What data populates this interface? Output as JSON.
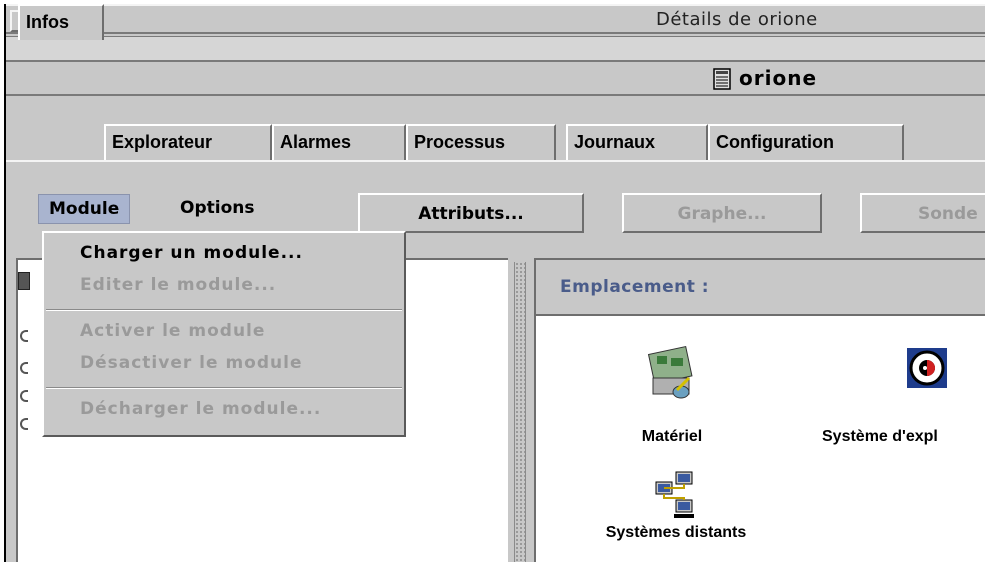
{
  "window": {
    "title": "Détails de orione"
  },
  "host": {
    "name": "orione"
  },
  "tabs": [
    {
      "label": "Infos"
    },
    {
      "label": "Explorateur"
    },
    {
      "label": "Alarmes"
    },
    {
      "label": "Processus"
    },
    {
      "label": "Journaux"
    },
    {
      "label": "Configuration"
    }
  ],
  "active_tab": "Explorateur",
  "menubar": {
    "module": "Module",
    "options": "Options"
  },
  "toolbar": {
    "attributes": "Attributs...",
    "graph": "Graphe...",
    "probe": "Sonde"
  },
  "module_menu": {
    "items": [
      {
        "label": "Charger un module...",
        "enabled": true
      },
      {
        "label": "Editer le module...",
        "enabled": false
      },
      {
        "label": "Activer le module",
        "enabled": false
      },
      {
        "label": "Désactiver le module",
        "enabled": false
      },
      {
        "label": "Décharger le module...",
        "enabled": false
      }
    ]
  },
  "right_panel": {
    "location_label": "Emplacement :",
    "icons": [
      {
        "label": "Matériel",
        "icon": "hardware-icon"
      },
      {
        "label": "Système d'expl",
        "icon": "operating-system-icon"
      },
      {
        "label": "Systèmes distants",
        "icon": "remote-systems-icon"
      }
    ]
  },
  "colors": {
    "background": "#c8c8c8",
    "menu_highlight": "#a9b4cf",
    "location_text": "#4a5c8a",
    "disabled_text": "#9a9a9a"
  }
}
